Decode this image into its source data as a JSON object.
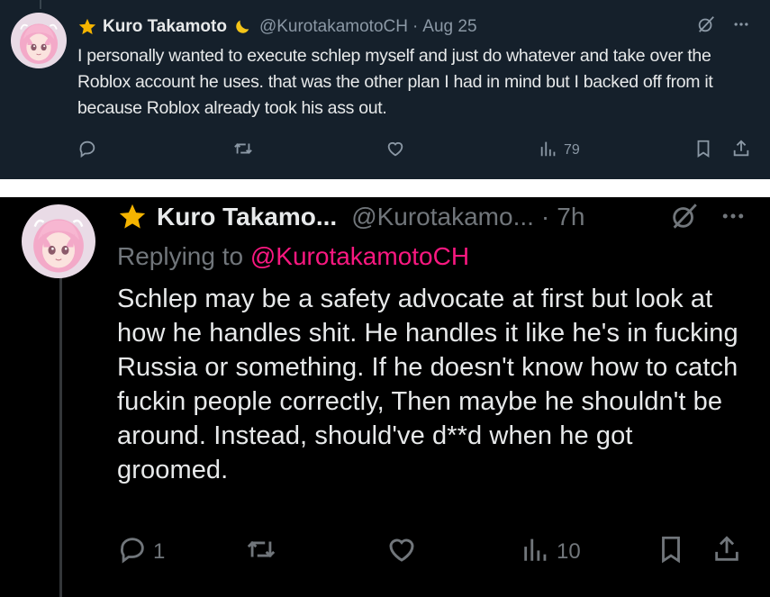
{
  "colors": {
    "dim_background": "#15202b",
    "black_background": "#000000",
    "text_primary": "#e7e9ea",
    "text_secondary": "#71767b",
    "mention_pink": "#f91880",
    "star_yellow": "#f5b400"
  },
  "tweet1": {
    "display_name": "Kuro Takamoto",
    "handle": "@KurotakamotoCH",
    "separator": "·",
    "time": "Aug 25",
    "text": "I personally wanted to execute schlep myself and just do whatever and take over the Roblox account he uses. that was the other plan I had in mind but I backed off from it because Roblox already took his ass out.",
    "icons": [
      "star-icon",
      "crescent-moon-icon",
      "grok-icon",
      "more-icon",
      "reply-icon",
      "retweet-icon",
      "like-icon",
      "views-icon",
      "bookmark-icon",
      "share-icon"
    ],
    "actions": {
      "replies": "",
      "retweets": "",
      "likes": "",
      "views": "79"
    }
  },
  "tweet2": {
    "display_name": "Kuro Takamo...",
    "handle": "@Kurotakamo...",
    "separator": "·",
    "time": "7h",
    "replying_prefix": "Replying to",
    "replying_handle": "@KurotakamotoCH",
    "text": "Schlep may be a safety advocate at first but look at how he handles shit. He handles it like he's in fucking Russia or something. If he doesn't know how to catch fuckin people correctly, Then maybe he shouldn't be around. Instead, should've d**d when he got groomed.",
    "actions": {
      "replies": "1",
      "retweets": "",
      "likes": "",
      "views": "10"
    }
  }
}
